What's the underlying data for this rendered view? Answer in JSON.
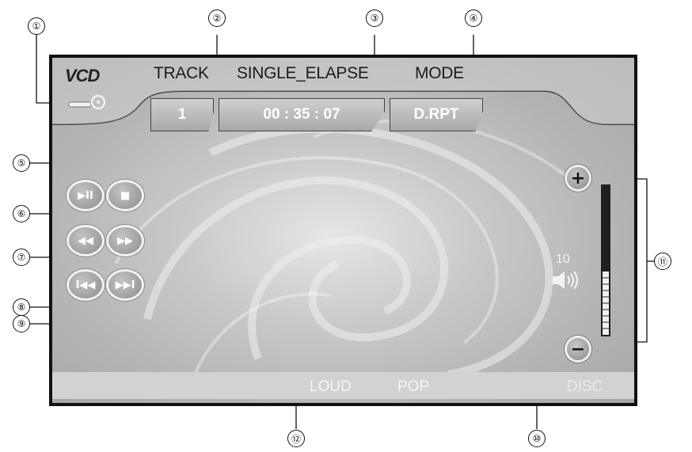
{
  "callouts": [
    "①",
    "②",
    "③",
    "④",
    "⑤",
    "⑥",
    "⑦",
    "⑧",
    "⑨",
    "⑩",
    "⑪",
    "⑫"
  ],
  "header": {
    "logo": "VCD",
    "track_label": "TRACK",
    "elapse_label": "SINGLE_ELAPSE",
    "mode_label": "MODE"
  },
  "values": {
    "track": "1",
    "elapsed": "00 : 35 : 07",
    "mode": "D.RPT"
  },
  "buttons": {
    "play_pause": "▶II",
    "stop": "■",
    "rewind": "◀◀",
    "fast_forward": "▶▶",
    "prev": "I◀◀",
    "next": "▶▶I"
  },
  "volume": {
    "level": "10",
    "plus": "+",
    "minus": "−"
  },
  "status": {
    "loud": "LOUD",
    "eq": "POP",
    "disc": "DISC"
  }
}
